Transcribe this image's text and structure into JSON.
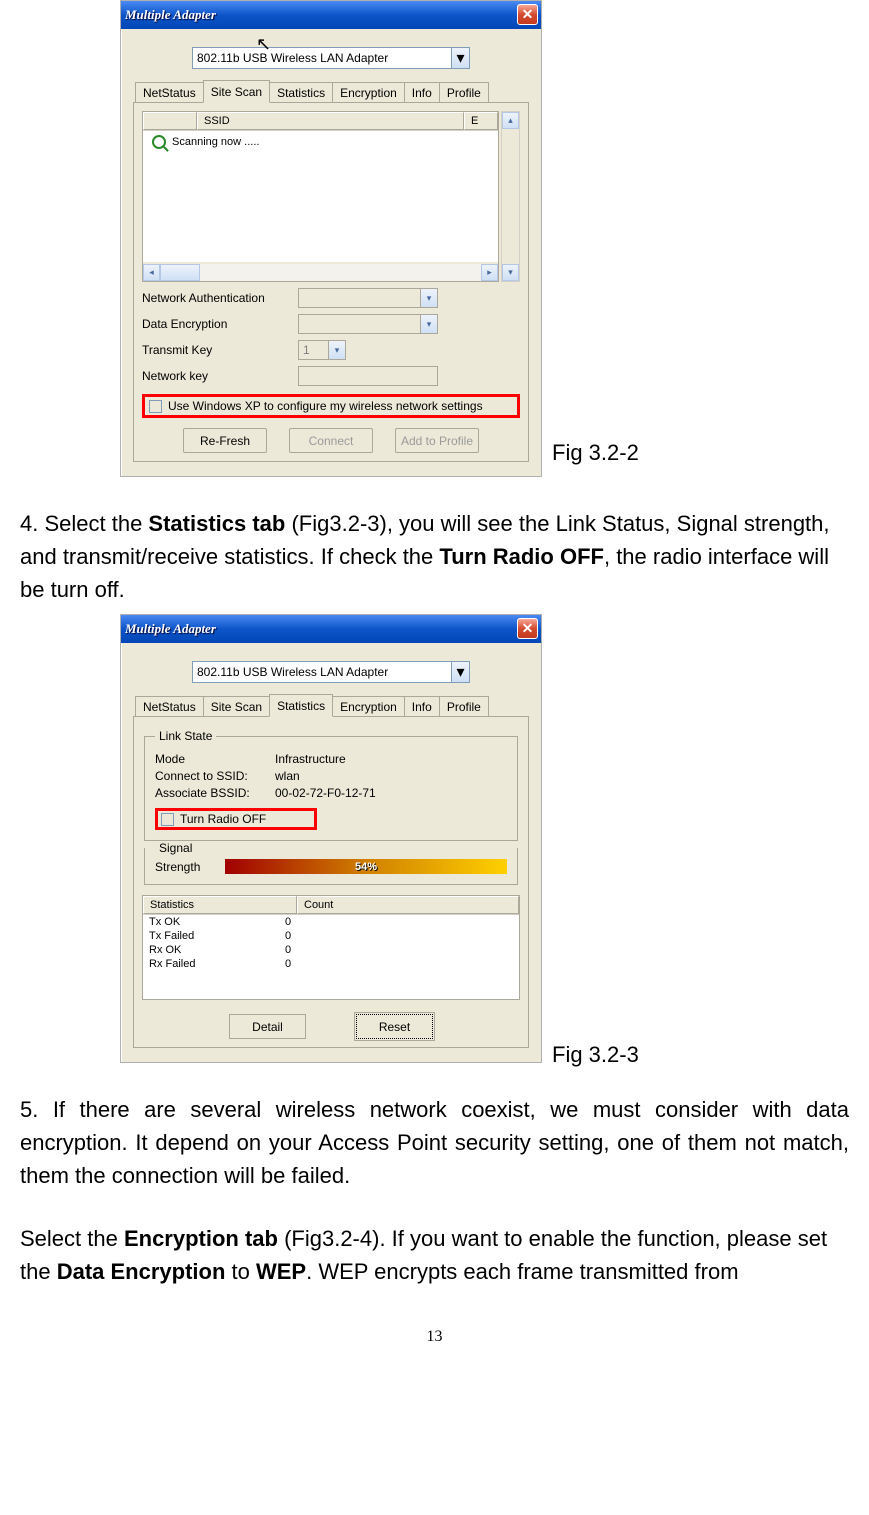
{
  "fig1": {
    "title": "Multiple Adapter",
    "close": "✕",
    "combo": "802.11b USB Wireless LAN Adapter",
    "tabs": [
      "NetStatus",
      "Site Scan",
      "Statistics",
      "Encryption",
      "Info",
      "Profile"
    ],
    "active_tab_index": 1,
    "list_headers": {
      "ssid": "SSID",
      "e": "E"
    },
    "scanning": "Scanning now .....",
    "fields": {
      "net_auth": "Network Authentication",
      "data_enc": "Data Encryption",
      "tx_key": "Transmit Key",
      "tx_key_val": "1",
      "net_key": "Network key"
    },
    "xp_checkbox": "Use Windows XP to configure my wireless network settings",
    "buttons": {
      "refresh": "Re-Fresh",
      "connect": "Connect",
      "add": "Add to Profile"
    },
    "caption": "Fig 3.2-2"
  },
  "para1": {
    "prefix": "4. Select the ",
    "b1": "Statistics tab",
    "mid": " (Fig3.2-3), you will see the Link Status, Signal strength, and transmit/receive statistics. If check the ",
    "b2": "Turn Radio OFF",
    "suffix": ", the radio interface will be turn off."
  },
  "fig2": {
    "title": "Multiple Adapter",
    "close": "✕",
    "combo": "802.11b USB Wireless LAN Adapter",
    "tabs": [
      "NetStatus",
      "Site Scan",
      "Statistics",
      "Encryption",
      "Info",
      "Profile"
    ],
    "active_tab_index": 2,
    "link_state_legend": "Link State",
    "mode_label": "Mode",
    "mode_val": "Infrastructure",
    "ssid_label": "Connect to SSID:",
    "ssid_val": "wlan",
    "bssid_label": "Associate BSSID:",
    "bssid_val": "00-02-72-F0-12-71",
    "turn_off": "Turn Radio OFF",
    "signal_legend": "Signal",
    "strength_label": "Strength",
    "strength_val": "54%",
    "stats_headers": {
      "stat": "Statistics",
      "count": "Count"
    },
    "stats": [
      {
        "name": "Tx OK",
        "count": "0"
      },
      {
        "name": "Tx Failed",
        "count": "0"
      },
      {
        "name": "Rx OK",
        "count": "0"
      },
      {
        "name": "Rx Failed",
        "count": "0"
      }
    ],
    "buttons": {
      "detail": "Detail",
      "reset": "Reset"
    },
    "caption": "Fig 3.2-3"
  },
  "para2": "5. If there are several wireless network coexist, we must consider with data encryption. It depend on your Access Point security setting, one of them not match, them the connection will be failed.",
  "para3": {
    "prefix": "Select the ",
    "b1": "Encryption tab",
    "mid1": " (Fig3.2-4). If you want to enable the function, please set the ",
    "b2": "Data Encryption",
    "mid2": " to ",
    "b3": "WEP",
    "suffix": ". WEP encrypts each frame transmitted from"
  },
  "page_number": "13"
}
